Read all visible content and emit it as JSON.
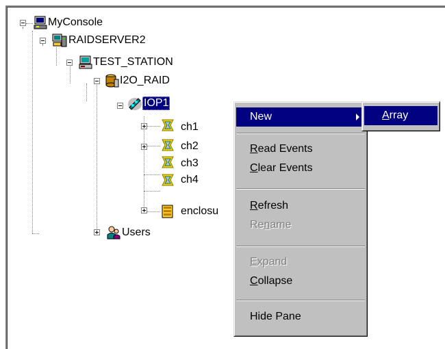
{
  "tree": {
    "root": "MyConsole",
    "server": "RAIDSERVER2",
    "station": "TEST_STATION",
    "raid": "I2O_RAID",
    "iop": "IOP1",
    "channels": [
      "ch1",
      "ch2",
      "ch3",
      "ch4"
    ],
    "enclosure": "enclosu",
    "users": "Users"
  },
  "context_menu": {
    "new": {
      "pre": "",
      "key": "",
      "post": "New"
    },
    "read_events": {
      "pre": "",
      "key": "R",
      "post": "ead Events"
    },
    "clear_events": {
      "pre": "",
      "key": "C",
      "post": "lear Events"
    },
    "refresh": {
      "pre": "",
      "key": "R",
      "post": "efresh"
    },
    "rename": {
      "pre": "Re",
      "key": "n",
      "post": "ame"
    },
    "expand": {
      "pre": "",
      "key": "E",
      "post": "xpand"
    },
    "collapse": {
      "pre": "",
      "key": "C",
      "post": "ollapse"
    },
    "hide_pane": {
      "pre": "",
      "key": "",
      "post": "Hide Pane"
    }
  },
  "submenu": {
    "array": {
      "pre": "",
      "key": "A",
      "post": "rray"
    }
  },
  "colors": {
    "selection": "#000080",
    "menu_face": "#c0c0c0",
    "disabled": "#808080"
  },
  "icons": {
    "root": "console-computer-icon",
    "server": "server-icon",
    "station": "workstation-icon",
    "raid": "raid-controller-icon",
    "iop": "iop-processor-icon",
    "channel": "channel-connector-icon",
    "enclosure": "enclosure-icon",
    "users": "users-icon"
  }
}
